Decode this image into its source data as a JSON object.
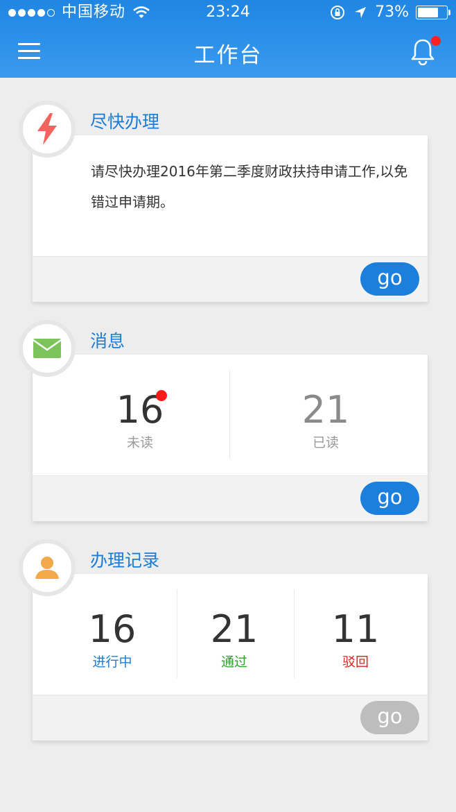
{
  "status_bar": {
    "carrier": "中国移动",
    "time": "23:24",
    "battery": "73%",
    "battery_level": 0.73
  },
  "header": {
    "title": "工作台"
  },
  "urgent": {
    "title": "尽快办理",
    "text": "请尽快办理2016年第二季度财政扶持申请工作,以免错过申请期。",
    "go_label": "go"
  },
  "messages": {
    "title": "消息",
    "unread_count": "16",
    "unread_label": "未读",
    "read_count": "21",
    "read_label": "已读",
    "go_label": "go"
  },
  "records": {
    "title": "办理记录",
    "in_progress_count": "16",
    "in_progress_label": "进行中",
    "passed_count": "21",
    "passed_label": "通过",
    "rejected_count": "11",
    "rejected_label": "驳回",
    "go_label": "go"
  },
  "colors": {
    "accent": "#1c7fdc",
    "title_blue": "#1a7cd6",
    "passed_green": "#2aa42a",
    "rejected_red": "#e02020",
    "badge_red": "#ff1a1a"
  },
  "icons": {
    "urgent": "lightning-icon",
    "messages": "envelope-icon",
    "records": "person-icon",
    "menu": "hamburger-icon",
    "notifications": "bell-icon"
  }
}
